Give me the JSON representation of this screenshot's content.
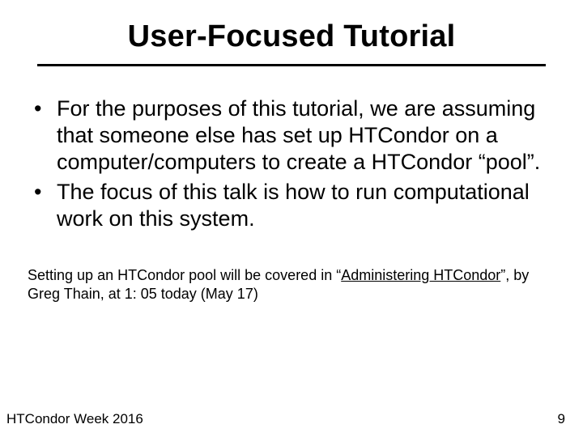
{
  "title": "User-Focused Tutorial",
  "bullets": [
    "For the purposes of this tutorial, we are assuming that someone else has set up HTCondor on a computer/computers to create a HTCondor “pool”.",
    "The focus of this talk is how to run computational work on this system."
  ],
  "note": {
    "prefix": "Setting up an HTCondor pool will be covered in “",
    "link_text": "Administering HTCondor",
    "suffix": "”, by Greg Thain, at 1: 05 today (May 17)"
  },
  "footer": {
    "left": "HTCondor Week 2016",
    "right": "9"
  }
}
